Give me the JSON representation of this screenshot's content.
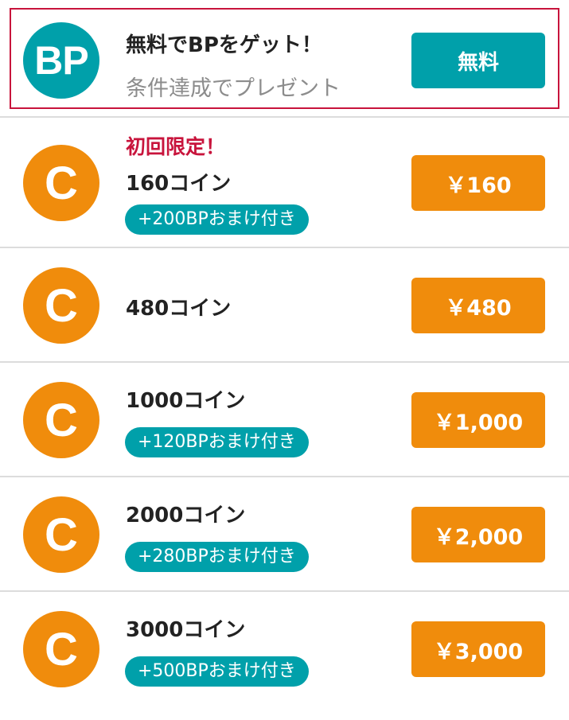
{
  "colors": {
    "teal": "#00a0aa",
    "orange": "#f08c0c",
    "highlight_border": "#c8143c",
    "promo_text": "#c8143c"
  },
  "free_offer": {
    "avatar_text": "BP",
    "title": "無料でBPをゲット！",
    "subtitle": "条件達成でプレゼント",
    "button_label": "無料"
  },
  "products": [
    {
      "avatar_text": "C",
      "promo": "初回限定！",
      "name": "160コイン",
      "bonus": "+200BPおまけ付き",
      "price": "￥160"
    },
    {
      "avatar_text": "C",
      "name": "480コイン",
      "price": "￥480"
    },
    {
      "avatar_text": "C",
      "name": "1000コイン",
      "bonus": "+120BPおまけ付き",
      "price": "￥1,000"
    },
    {
      "avatar_text": "C",
      "name": "2000コイン",
      "bonus": "+280BPおまけ付き",
      "price": "￥2,000"
    },
    {
      "avatar_text": "C",
      "name": "3000コイン",
      "bonus": "+500BPおまけ付き",
      "price": "￥3,000"
    }
  ]
}
